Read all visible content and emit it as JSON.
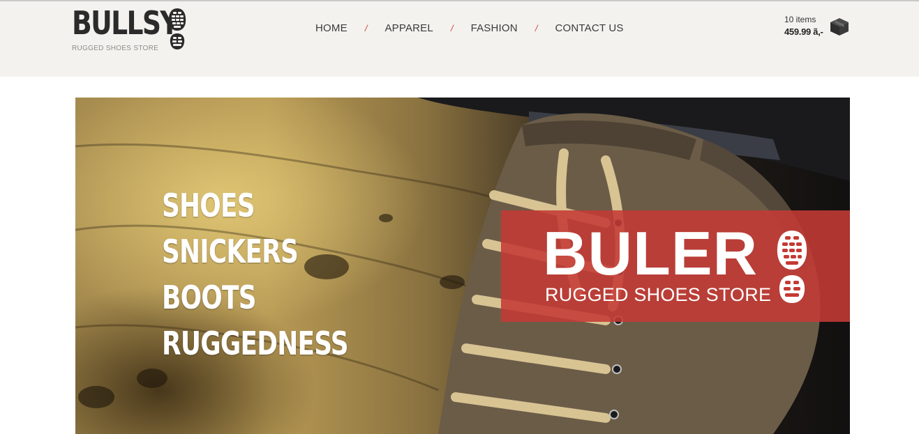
{
  "brand": {
    "name": "BULLSY",
    "tagline": "RUGGED SHOES STORE",
    "logo_icon": "shoe-sole-icon"
  },
  "nav": {
    "items": [
      {
        "label": "HOME"
      },
      {
        "label": "APPAREL"
      },
      {
        "label": "FASHION"
      },
      {
        "label": "CONTACT US"
      }
    ],
    "separator": "/"
  },
  "cart": {
    "items_text": "10 items",
    "total": "459.99 ã,-",
    "icon": "box-icon"
  },
  "hero": {
    "words": [
      "SHOES",
      "SNICKERS",
      "BOOTS",
      "RUGGEDNESS"
    ],
    "banner": {
      "title": "BULER",
      "subtitle": "RUGGED SHOES STORE",
      "icon": "shoe-sole-icon"
    }
  },
  "colors": {
    "accent": "#c43a34",
    "header_bg": "#f3f2ee",
    "text_dark": "#2b2b2b"
  }
}
